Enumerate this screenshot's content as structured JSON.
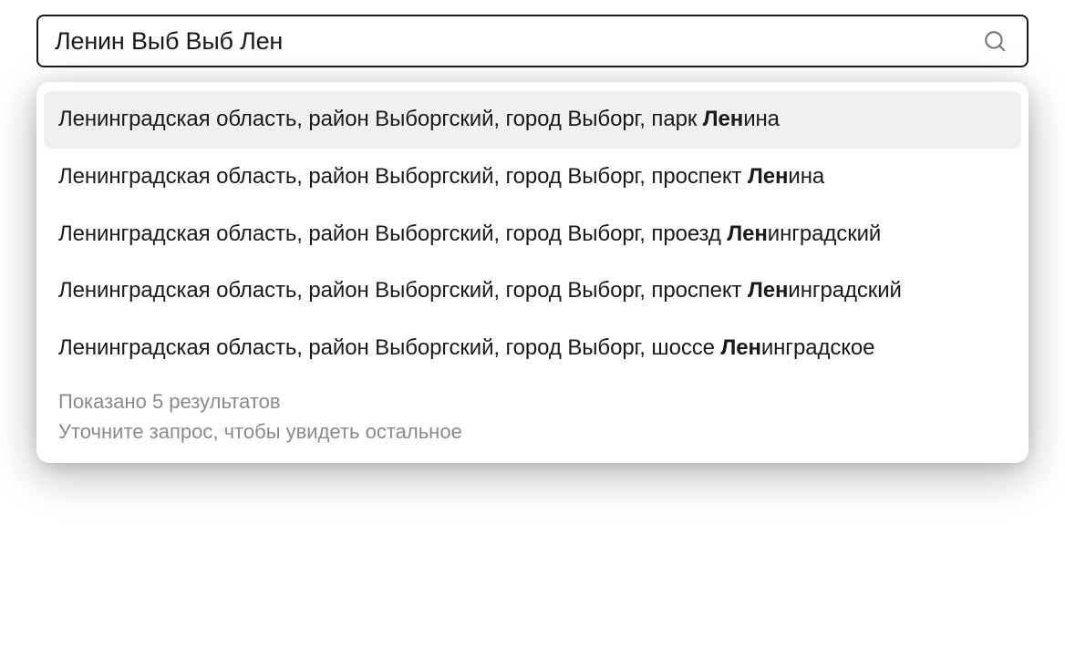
{
  "search": {
    "value": "Ленин Выб Выб Лен"
  },
  "highlight_token": "Лен",
  "suggestions": [
    {
      "text": "Ленинградская область, район Выборгский, город Выборг, парк Ленина",
      "highlighted": true
    },
    {
      "text": "Ленинградская область, район Выборгский, город Выборг, проспект Ленина",
      "highlighted": false
    },
    {
      "text": "Ленинградская область, район Выборгский, город Выборг, проезд Ленинградский",
      "highlighted": false
    },
    {
      "text": "Ленинградская область, район Выборгский, город Выборг, проспект Ленинградский",
      "highlighted": false
    },
    {
      "text": "Ленинградская область, район Выборгский, город Выборг, шоссе Ленинградское",
      "highlighted": false
    }
  ],
  "footer": {
    "line1": "Показано 5 результатов",
    "line2": "Уточните запрос, чтобы увидеть остальное"
  }
}
